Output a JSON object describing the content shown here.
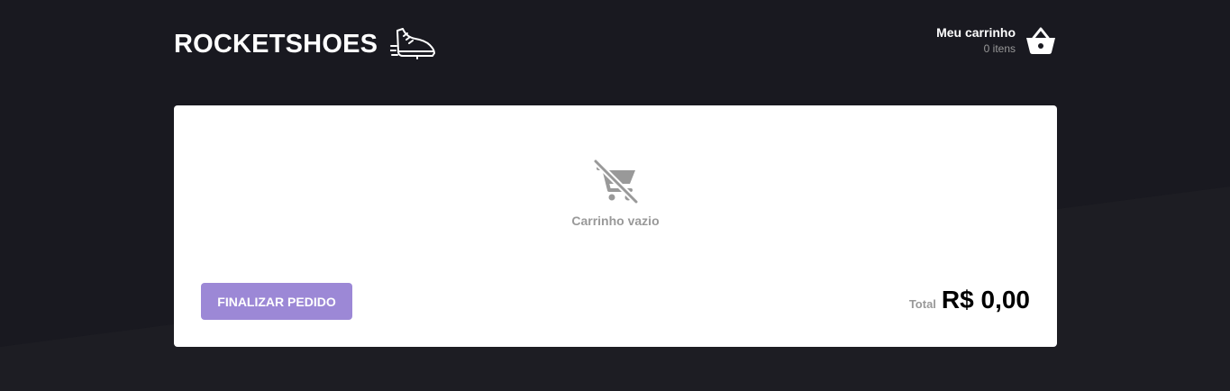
{
  "header": {
    "logo_text": "ROCKETSHOES",
    "logo_icon": "sneaker-icon",
    "cart_title": "Meu carrinho",
    "cart_count": "0 itens",
    "cart_icon": "basket-icon"
  },
  "cart": {
    "empty_icon": "remove-shopping-cart-icon",
    "empty_text": "Carrinho vazio",
    "finish_label": "FINALIZAR PEDIDO",
    "total_label": "Total",
    "total_value": "R$ 0,00"
  },
  "colors": {
    "background": "#191920",
    "accent": "#9c88d6",
    "panel": "#ffffff",
    "muted_text": "#999999"
  }
}
